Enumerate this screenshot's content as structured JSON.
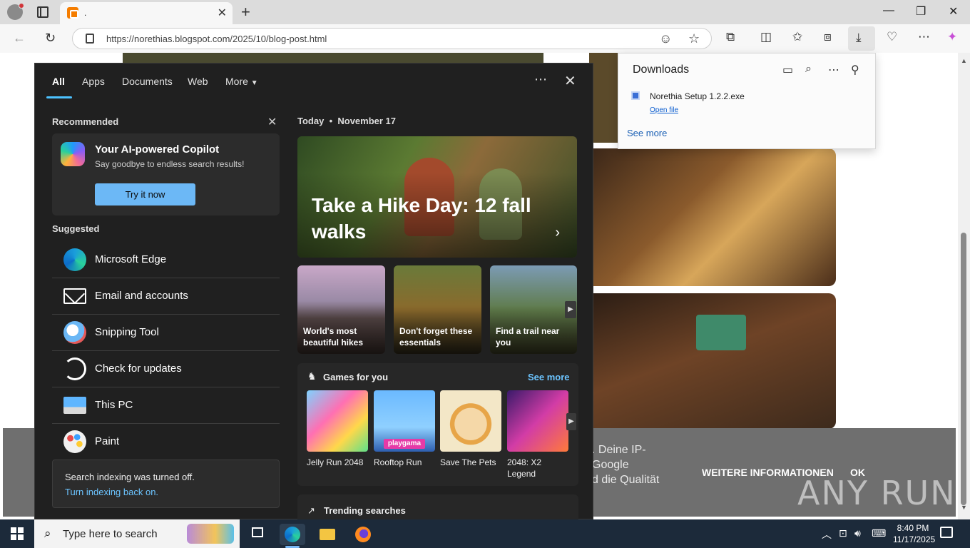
{
  "browser": {
    "tab_title": ".",
    "url": "https://norethias.blogspot.com/2025/10/blog-post.html",
    "window_controls": [
      "—",
      "❐",
      "✕"
    ]
  },
  "downloads": {
    "title": "Downloads",
    "file_name": "Norethia Setup 1.2.2.exe",
    "open_file": "Open file",
    "see_more": "See more"
  },
  "cookie": {
    "text": ". Deine IP-\nGoogle\nd die Qualität",
    "more_info": "WEITERE INFORMATIONEN",
    "ok": "OK"
  },
  "watermark": "ANY RUN",
  "search_panel": {
    "tabs": [
      "All",
      "Apps",
      "Documents",
      "Web",
      "More"
    ],
    "recommended_label": "Recommended",
    "copilot": {
      "title": "Your AI-powered Copilot",
      "subtitle": "Say goodbye to endless search results!",
      "button": "Try it now"
    },
    "suggested_label": "Suggested",
    "suggested": [
      {
        "label": "Microsoft Edge",
        "icon": "edge-icon"
      },
      {
        "label": "Email and accounts",
        "icon": "mail-icon"
      },
      {
        "label": "Snipping Tool",
        "icon": "snipping-tool-icon"
      },
      {
        "label": "Check for updates",
        "icon": "update-icon"
      },
      {
        "label": "This PC",
        "icon": "pc-icon"
      },
      {
        "label": "Paint",
        "icon": "paint-icon"
      }
    ],
    "indexing": {
      "text": "Search indexing was turned off.",
      "link": "Turn indexing back on."
    },
    "today": {
      "label": "Today",
      "date": "November 17"
    },
    "hero_title": "Take a Hike Day: 12 fall walks",
    "thumbs": [
      "World's most beautiful hikes",
      "Don't forget these essentials",
      "Find a trail near you"
    ],
    "games": {
      "header": "Games for you",
      "see_more": "See more",
      "items": [
        "Jelly Run 2048",
        "Rooftop Run",
        "Save The Pets",
        "2048: X2 Legend"
      ],
      "badge": "playgama"
    },
    "trending": "Trending searches"
  },
  "taskbar": {
    "search_placeholder": "Type here to search",
    "time": "8:40 PM",
    "date": "11/17/2025"
  }
}
